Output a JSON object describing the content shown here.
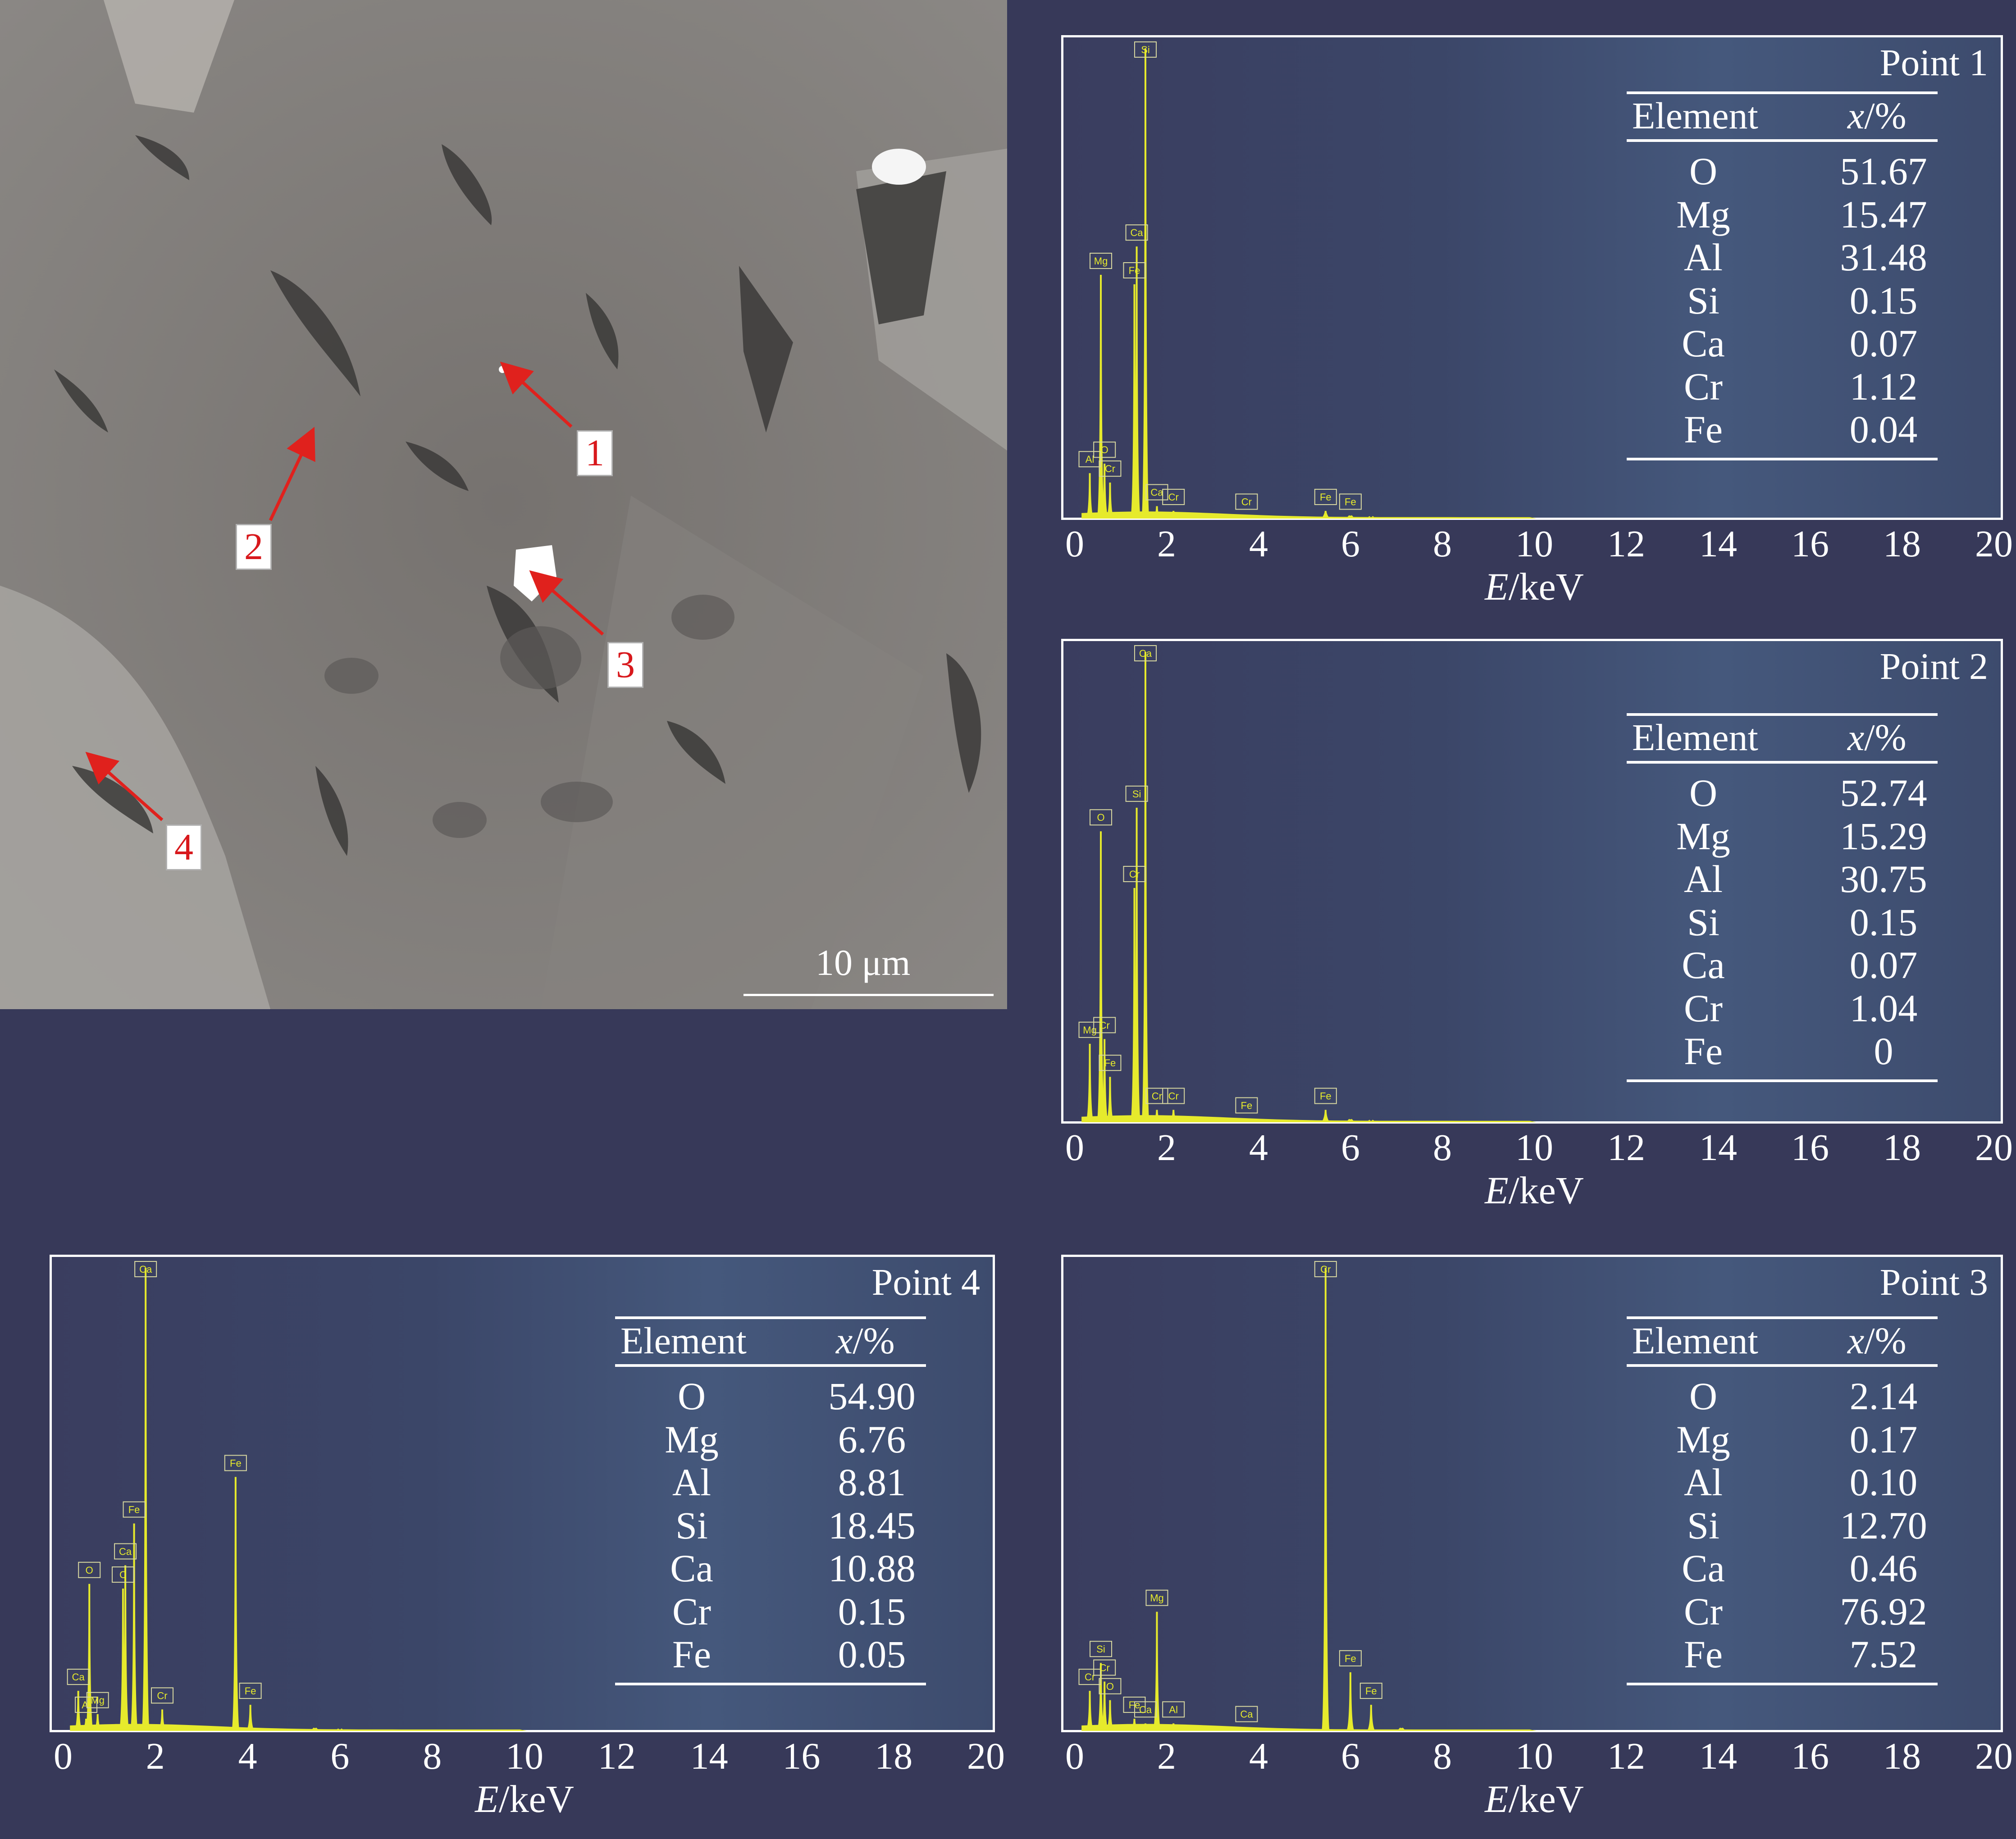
{
  "image": {
    "scale_bar_label": "10 μm",
    "markers": [
      "1",
      "2",
      "3",
      "4"
    ]
  },
  "colors": {
    "background": "#373959",
    "spectrum": "#e6ea2c",
    "marker_text": "#d8181c",
    "arrow": "#e0211d",
    "frame": "#ffffff"
  },
  "table_headers": {
    "element": "Element",
    "fraction": "x/%"
  },
  "x_axis": {
    "label_italic": "E",
    "label_rest": "/keV"
  },
  "chart_data": [
    {
      "type": "bar",
      "title": "Point 1",
      "xlim": [
        0,
        20
      ],
      "x_ticks": [
        0,
        2,
        4,
        6,
        8,
        10,
        12,
        14,
        16,
        18,
        20
      ],
      "peaks": [
        {
          "x": 0.28,
          "y": 0.1
        },
        {
          "x": 0.52,
          "y": 0.52
        },
        {
          "x": 0.6,
          "y": 0.12
        },
        {
          "x": 0.72,
          "y": 0.08
        },
        {
          "x": 1.25,
          "y": 0.5
        },
        {
          "x": 1.3,
          "y": 0.58
        },
        {
          "x": 1.49,
          "y": 1.0
        },
        {
          "x": 1.74,
          "y": 0.03
        },
        {
          "x": 2.1,
          "y": 0.02
        },
        {
          "x": 3.69,
          "y": 0.01
        },
        {
          "x": 5.41,
          "y": 0.02
        },
        {
          "x": 5.95,
          "y": 0.01
        },
        {
          "x": 6.4,
          "y": 0.005
        }
      ],
      "peak_labels": [
        "Al",
        "Mg",
        "O",
        "Cr",
        "Fe",
        "Ca",
        "Si",
        "Ca",
        "Cr",
        "Cr",
        "Fe",
        "Fe"
      ],
      "table": [
        {
          "element": "O",
          "value": "51.67"
        },
        {
          "element": "Mg",
          "value": "15.47"
        },
        {
          "element": "Al",
          "value": "31.48"
        },
        {
          "element": "Si",
          "value": "0.15"
        },
        {
          "element": "Ca",
          "value": "0.07"
        },
        {
          "element": "Cr",
          "value": "1.12"
        },
        {
          "element": "Fe",
          "value": "0.04"
        }
      ]
    },
    {
      "type": "bar",
      "title": "Point 2",
      "xlim": [
        0,
        20
      ],
      "x_ticks": [
        0,
        2,
        4,
        6,
        8,
        10,
        12,
        14,
        16,
        18,
        20
      ],
      "peaks": [
        {
          "x": 0.28,
          "y": 0.17
        },
        {
          "x": 0.52,
          "y": 0.62
        },
        {
          "x": 0.6,
          "y": 0.18
        },
        {
          "x": 0.72,
          "y": 0.1
        },
        {
          "x": 1.25,
          "y": 0.5
        },
        {
          "x": 1.3,
          "y": 0.67
        },
        {
          "x": 1.49,
          "y": 1.0
        },
        {
          "x": 1.74,
          "y": 0.03
        },
        {
          "x": 2.1,
          "y": 0.03
        },
        {
          "x": 3.69,
          "y": 0.01
        },
        {
          "x": 5.41,
          "y": 0.03
        },
        {
          "x": 5.95,
          "y": 0.01
        },
        {
          "x": 6.4,
          "y": 0.005
        }
      ],
      "peak_labels": [
        "Mg",
        "O",
        "Cr",
        "Fe",
        "Cr",
        "Si",
        "Ca",
        "Cr",
        "Cr",
        "Fe",
        "Fe"
      ],
      "table": [
        {
          "element": "O",
          "value": "52.74"
        },
        {
          "element": "Mg",
          "value": "15.29"
        },
        {
          "element": "Al",
          "value": "30.75"
        },
        {
          "element": "Si",
          "value": "0.15"
        },
        {
          "element": "Ca",
          "value": "0.07"
        },
        {
          "element": "Cr",
          "value": "1.04"
        },
        {
          "element": "Fe",
          "value": "0"
        }
      ]
    },
    {
      "type": "bar",
      "title": "Point 4",
      "xlim": [
        0,
        20
      ],
      "x_ticks": [
        0,
        2,
        4,
        6,
        8,
        10,
        12,
        14,
        16,
        18,
        20
      ],
      "peaks": [
        {
          "x": 0.28,
          "y": 0.09
        },
        {
          "x": 0.45,
          "y": 0.03
        },
        {
          "x": 0.52,
          "y": 0.32
        },
        {
          "x": 0.7,
          "y": 0.04
        },
        {
          "x": 1.25,
          "y": 0.31
        },
        {
          "x": 1.3,
          "y": 0.36
        },
        {
          "x": 1.49,
          "y": 0.45
        },
        {
          "x": 1.74,
          "y": 1.0
        },
        {
          "x": 2.1,
          "y": 0.05
        },
        {
          "x": 3.69,
          "y": 0.55
        },
        {
          "x": 4.01,
          "y": 0.06
        },
        {
          "x": 5.41,
          "y": 0.01
        },
        {
          "x": 5.95,
          "y": 0.005
        }
      ],
      "peak_labels": [
        "Ca",
        "Al",
        "O",
        "Mg",
        "C",
        "Ca",
        "Fe",
        "Ca",
        "Cr",
        "Fe",
        "Fe"
      ],
      "table": [
        {
          "element": "O",
          "value": "54.90"
        },
        {
          "element": "Mg",
          "value": "6.76"
        },
        {
          "element": "Al",
          "value": "8.81"
        },
        {
          "element": "Si",
          "value": "18.45"
        },
        {
          "element": "Ca",
          "value": "10.88"
        },
        {
          "element": "Cr",
          "value": "0.15"
        },
        {
          "element": "Fe",
          "value": "0.05"
        }
      ]
    },
    {
      "type": "bar",
      "title": "Point 3",
      "xlim": [
        0,
        20
      ],
      "x_ticks": [
        0,
        2,
        4,
        6,
        8,
        10,
        12,
        14,
        16,
        18,
        20
      ],
      "peaks": [
        {
          "x": 0.28,
          "y": 0.09
        },
        {
          "x": 0.52,
          "y": 0.15
        },
        {
          "x": 0.6,
          "y": 0.11
        },
        {
          "x": 0.72,
          "y": 0.07
        },
        {
          "x": 1.25,
          "y": 0.03
        },
        {
          "x": 1.49,
          "y": 0.02
        },
        {
          "x": 1.74,
          "y": 0.26
        },
        {
          "x": 2.1,
          "y": 0.02
        },
        {
          "x": 3.69,
          "y": 0.01
        },
        {
          "x": 5.41,
          "y": 1.0
        },
        {
          "x": 5.95,
          "y": 0.13
        },
        {
          "x": 6.4,
          "y": 0.06
        },
        {
          "x": 7.06,
          "y": 0.01
        }
      ],
      "peak_labels": [
        "Cr",
        "Si",
        "Cr",
        "O",
        "Fe",
        "Ca",
        "Mg",
        "Al",
        "Ca",
        "Cr",
        "Fe",
        "Fe"
      ],
      "table": [
        {
          "element": "O",
          "value": "2.14"
        },
        {
          "element": "Mg",
          "value": "0.17"
        },
        {
          "element": "Al",
          "value": "0.10"
        },
        {
          "element": "Si",
          "value": "12.70"
        },
        {
          "element": "Ca",
          "value": "0.46"
        },
        {
          "element": "Cr",
          "value": "76.92"
        },
        {
          "element": "Fe",
          "value": "7.52"
        }
      ]
    }
  ]
}
